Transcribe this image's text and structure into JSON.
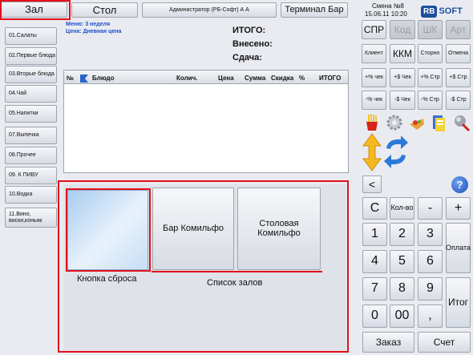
{
  "header": {
    "hall_tab": "Зал",
    "table_tab": "Стол",
    "user": "Администратор (РБ-Софт) А А",
    "terminal": "Терминал Бар",
    "shift": "Смена №8",
    "datetime": "15.06.11 10:20",
    "logo_rb": "RB",
    "logo_soft": "SOFT"
  },
  "menu_info": {
    "menu": "Меню: 3 неделя",
    "price": "Цена: Дневная цена"
  },
  "totals": {
    "total": "ИТОГО:",
    "paid": "Внесено:",
    "change": "Сдача:"
  },
  "categories": [
    "01.Салаты",
    "02.Первые блюда",
    "03.Вторые блюда",
    "04.Чай",
    "05.Напитки",
    "07.Выпечка",
    "08.Прочее",
    "09. К ПИВУ",
    "10.Водка",
    "11.Вино, виски,коньяк"
  ],
  "table_headers": [
    "№",
    "Блюдо",
    "Колич.",
    "Цена",
    "Сумма",
    "Скидка",
    "%",
    "ИТОГО"
  ],
  "halls": {
    "reset_label": "Кнопка сброса",
    "list_label": "Список залов",
    "items": [
      "Бар Комильфо",
      "Столовая Комильфо"
    ]
  },
  "right_panel": {
    "row1": [
      "СПР",
      "Код",
      "ШК",
      "Арт"
    ],
    "row2": [
      "Клиент",
      "ККМ",
      "Сторно",
      "Отмена"
    ],
    "row3": [
      "+% чек",
      "+$ Чек",
      "+% Стр",
      "+$ Стр"
    ],
    "row4": [
      "-% чек",
      "-$ Чек",
      "-% Стр",
      "-$ Стр"
    ],
    "back": "<",
    "help": "?"
  },
  "keypad": {
    "clear": "C",
    "qty": "Кол-во",
    "minus": "-",
    "plus": "+",
    "digits": [
      "1",
      "2",
      "3",
      "4",
      "5",
      "6",
      "7",
      "8",
      "9",
      "0",
      "00",
      ","
    ],
    "payment": "Оплата",
    "total": "Итог",
    "order": "Заказ",
    "bill": "Счет"
  },
  "colors": {
    "red_highlight": "#e3101a",
    "accent_blue": "#1f5fc8",
    "logo_blue": "#1d4f9c"
  }
}
